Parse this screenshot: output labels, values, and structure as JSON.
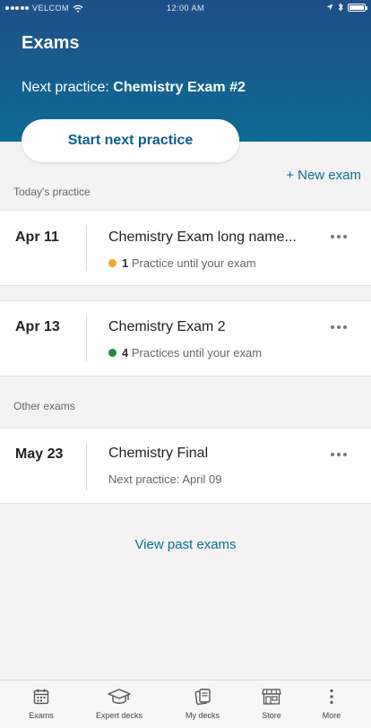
{
  "status_bar": {
    "carrier": "VELCOM",
    "time": "12:00 AM"
  },
  "header": {
    "title": "Exams",
    "next_practice_prefix": "Next practice:",
    "next_practice_exam": "Chemistry Exam #2",
    "start_button_label": "Start next practice"
  },
  "new_exam_label": "+ New exam",
  "todays_practice": {
    "label": "Today's practice",
    "items": [
      {
        "date": "Apr 11",
        "name": "Chemistry Exam long name...",
        "count": "1",
        "count_text": "Practice until your exam",
        "dot_color": "#f5a623"
      },
      {
        "date": "Apr 13",
        "name": "Chemistry Exam 2",
        "count": "4",
        "count_text": "Practices until your exam",
        "dot_color": "#1e8e3e"
      }
    ]
  },
  "other_exams": {
    "label": "Other exams",
    "items": [
      {
        "date": "May 23",
        "name": "Chemistry Final",
        "subtitle": "Next practice: April 09"
      }
    ]
  },
  "view_past_label": "View past exams",
  "tabs": [
    {
      "label": "Exams",
      "icon": "calendar-icon"
    },
    {
      "label": "Expert decks",
      "icon": "graduation-cap-icon"
    },
    {
      "label": "My decks",
      "icon": "cards-icon"
    },
    {
      "label": "Store",
      "icon": "store-icon"
    },
    {
      "label": "More",
      "icon": "more-vertical-icon"
    }
  ],
  "colors": {
    "header_gradient_top": "#1f4f87",
    "header_gradient_bottom": "#0e6b94",
    "accent": "#0d6e91"
  }
}
